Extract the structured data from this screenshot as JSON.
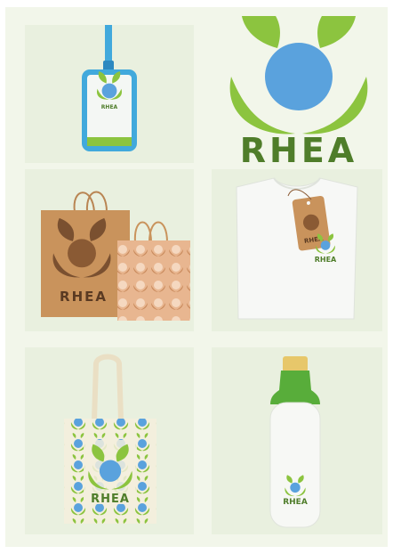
{
  "brand": {
    "name": "RHEA",
    "colors": {
      "leaf_green": "#8cc43f",
      "dark_green": "#4f7d2a",
      "sky_blue": "#5aa2dd",
      "kraft": "#c9935c",
      "kraft_dark": "#8a5a34",
      "lanyard_blue": "#41a9dc"
    }
  },
  "mockups": {
    "badge": {
      "label": "RHEA"
    },
    "logo": {
      "text": "RHEA"
    },
    "shopping_bag": {
      "text": "RHEA"
    },
    "tshirt_tag": {
      "text": "RHEA"
    },
    "tshirt_print": {
      "text": "RHEA"
    },
    "tote_bag": {
      "text": "RHEA"
    },
    "bottle": {
      "text": "RHEA"
    }
  }
}
